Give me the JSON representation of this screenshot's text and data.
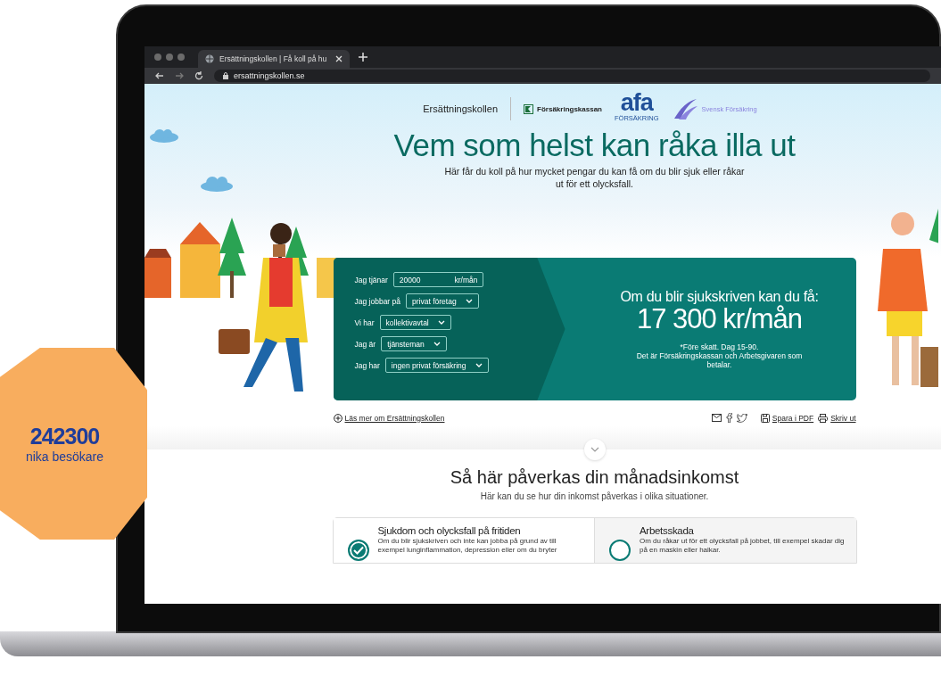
{
  "browser": {
    "tab_title": "Ersättningskollen | Få koll på hu",
    "url": "ersattningskollen.se"
  },
  "header": {
    "brand": "Ersättningskollen",
    "partners": [
      {
        "kind": "fk",
        "name": "Försäkringskassan"
      },
      {
        "kind": "afa",
        "name": "afa",
        "sub": "FÖRSÄKRING"
      },
      {
        "kind": "sf",
        "name": "Svensk Försäkring"
      }
    ]
  },
  "hero": {
    "title": "Vem som helst kan råka illa ut",
    "subtitle": "Här får du koll på hur mycket pengar du kan få om du blir sjuk eller råkar ut för ett olycksfall."
  },
  "calculator": {
    "rows": [
      {
        "kind": "input",
        "label": "Jag tjänar",
        "value": "20000",
        "unit": "kr/mån"
      },
      {
        "kind": "select",
        "label": "Jag jobbar på",
        "value": "privat företag"
      },
      {
        "kind": "select",
        "label": "Vi har",
        "value": "kollektivavtal"
      },
      {
        "kind": "select",
        "label": "Jag är",
        "value": "tjänsteman"
      },
      {
        "kind": "select",
        "label": "Jag har",
        "value": "ingen privat försäkring"
      }
    ],
    "result": {
      "heading": "Om du blir sjukskriven kan du få:",
      "amount": "17 300 kr/mån",
      "note": "*Före skatt. Dag 15-90.",
      "payer": "Det är Försäkringskassan och Arbetsgivaren som betalar."
    }
  },
  "actions": {
    "read_more": "Läs mer om Ersättningskollen",
    "save_pdf": "Spara i PDF",
    "print": "Skriv ut"
  },
  "section": {
    "title": "Så här påverkas din månadsinkomst",
    "subtitle": "Här kan du se hur din inkomst påverkas i olika situationer.",
    "options": [
      {
        "title": "Sjukdom och olycksfall på fritiden",
        "text": "Om du blir sjukskriven och inte kan jobba på grund av till exempel lunginflammation, depression eller om du bryter",
        "selected": true
      },
      {
        "title": "Arbetsskada",
        "text": "Om du råkar ut för ett olycksfall på jobbet, till exempel skadar dig på en maskin eller halkar.",
        "selected": false
      }
    ]
  },
  "badge": {
    "number": "242300",
    "label": "nika besökare"
  }
}
